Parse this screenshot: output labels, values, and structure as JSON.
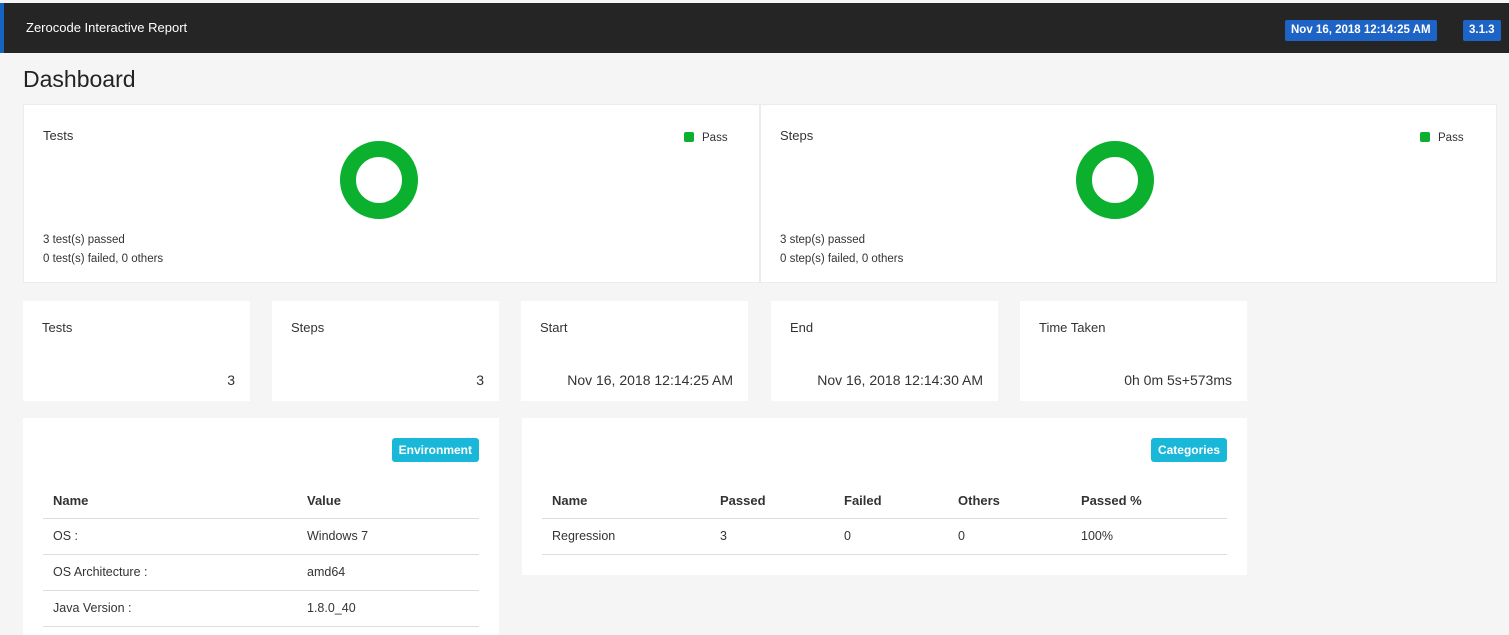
{
  "header": {
    "title": "Zerocode Interactive Report",
    "date": "Nov 16, 2018 12:14:25 AM",
    "version": "3.1.3"
  },
  "page": {
    "title": "Dashboard"
  },
  "summary": {
    "tests": {
      "label": "Tests",
      "legend": "Pass",
      "passed_text": "3 test(s) passed",
      "failed_text": "0 test(s) failed, 0 others",
      "pass_fraction": 1.0
    },
    "steps": {
      "label": "Steps",
      "legend": "Pass",
      "passed_text": "3 step(s) passed",
      "failed_text": "0 step(s) failed, 0 others",
      "pass_fraction": 1.0
    }
  },
  "stats": [
    {
      "label": "Tests",
      "value": "3"
    },
    {
      "label": "Steps",
      "value": "3"
    },
    {
      "label": "Start",
      "value": "Nov 16, 2018 12:14:25 AM"
    },
    {
      "label": "End",
      "value": "Nov 16, 2018 12:14:30 AM"
    },
    {
      "label": "Time Taken",
      "value": "0h 0m 5s+573ms"
    }
  ],
  "environment": {
    "badge": "Environment",
    "headers": [
      "Name",
      "Value"
    ],
    "rows": [
      [
        "OS :",
        "Windows 7"
      ],
      [
        "OS Architecture :",
        "amd64"
      ],
      [
        "Java Version :",
        "1.8.0_40"
      ]
    ]
  },
  "categories": {
    "badge": "Categories",
    "headers": [
      "Name",
      "Passed",
      "Failed",
      "Others",
      "Passed %"
    ],
    "rows": [
      [
        "Regression",
        "3",
        "0",
        "0",
        "100%"
      ]
    ]
  },
  "colors": {
    "pass": "#0bb02e",
    "header_bg": "#252525",
    "badge_blue": "#1e63c6",
    "pill_cyan": "#1ab8d8"
  }
}
